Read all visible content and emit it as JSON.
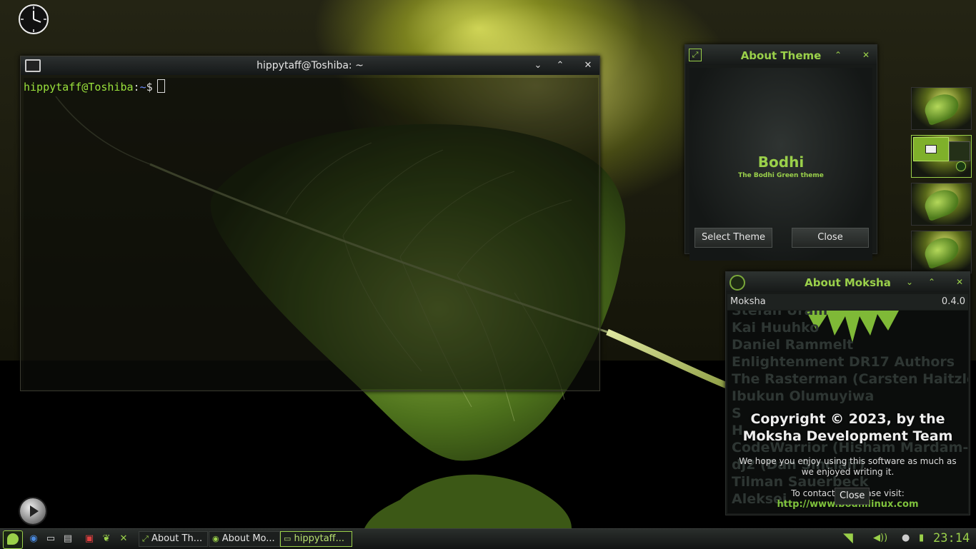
{
  "terminal": {
    "title": "hippytaff@Toshiba: ~",
    "prompt_user": "hippytaff@Toshiba",
    "prompt_sep": ":",
    "prompt_dir": "~",
    "prompt_end": "$",
    "buttons": {
      "minimize": "⌄",
      "maximize": "⌃",
      "close": "✕"
    }
  },
  "about_theme": {
    "title": "About Theme",
    "theme_name": "Bodhi",
    "theme_desc": "The Bodhi Green theme",
    "select_button": "Select Theme",
    "close_button": "Close"
  },
  "about_moksha": {
    "title": "About Moksha",
    "app_name": "Moksha",
    "version": "0.4.0",
    "credits": [
      "Stefan Uram",
      "Kai Huuhko",
      "Daniel Rammelt",
      "Enlightenment DR17 Authors",
      "The Rasterman (Carsten Haitzler)",
      "Ibukun Olumuyiwa",
      "S",
      "H",
      "CodeWarrior (Hisham Mardam-Bey)",
      "dj2 (Dan Sinclair)",
      "Tilman Sauerbeck",
      "Aleksej"
    ],
    "copyright_line1": "Copyright © 2023, by the",
    "copyright_line2": "Moksha Development Team",
    "hope_text": "We hope you enjoy using this software as much as we enjoyed writing it.",
    "contact_text": "To contact us, please visit:",
    "url": "http://www.bodhilinux.com",
    "close_button": "Close"
  },
  "taskbar": {
    "tasks": [
      {
        "label": "About Th..."
      },
      {
        "label": "About Mo..."
      },
      {
        "label": "hippytaff..."
      }
    ],
    "clock": "23:14"
  },
  "colors": {
    "accent": "#9ad04a",
    "prompt_user": "#9ae23c",
    "prompt_dir": "#6c8cff"
  }
}
